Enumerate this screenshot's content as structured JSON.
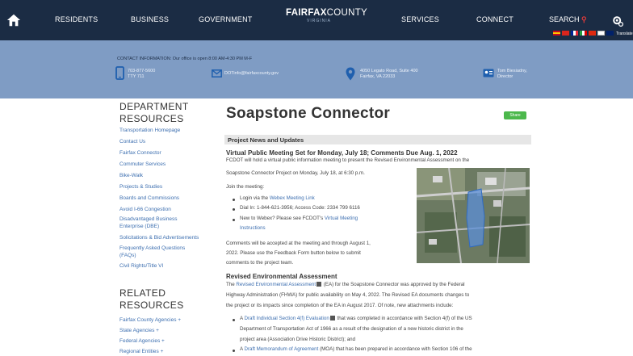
{
  "nav": {
    "residents": "RESIDENTS",
    "business": "BUSINESS",
    "government": "GOVERNMENT",
    "brand_bold": "FAIRFAX",
    "brand_thin": "COUNTY",
    "brand_sub": "VIRGINIA",
    "services": "SERVICES",
    "connect": "CONNECT",
    "search": "SEARCH",
    "translate": "Translate"
  },
  "contact": {
    "label": "CONTACT INFORMATION: Our office is open 8:00 AM-4:30 PM M-F",
    "phone": [
      "703-877-5600",
      "TTY 711"
    ],
    "email": "DOTinfo@fairfaxcounty.gov",
    "address": [
      "4050 Legato Road, Suite 400",
      "Fairfax, VA 22033"
    ],
    "person": [
      "Tom Biesiadny,",
      "Director"
    ]
  },
  "sidebar": {
    "dept_heading": [
      "DEPARTMENT",
      "RESOURCES"
    ],
    "links": [
      "Transportation Homepage",
      "Contact Us",
      "Fairfax Connector",
      "Commuter Services",
      "Bike-Walk",
      "Projects & Studies",
      "Boards and Commissions",
      "Avoid I-66 Congestion",
      "Disadvantaged Business",
      "Enterprise (DBE)",
      "Solicitations & Bid Advertisements",
      "Frequently Asked Questions",
      "(FAQs)",
      "Civil Rights/Title VI"
    ],
    "related_heading": [
      "RELATED",
      "RESOURCES"
    ],
    "related_links": [
      "Fairfax County Agencies  +",
      "State Agencies  +",
      "Federal Agencies  +",
      "Regional Entities  +"
    ]
  },
  "main": {
    "title": "Soapstone Connector",
    "share": "Share",
    "section": "Project News and Updates",
    "h1": "Virtual Public Meeting Set for Monday, July 18; Comments Due Aug. 1, 2022",
    "p1a": "FCDOT will hold a virtual public information meeting to present the Revised Environmental Assessment on the",
    "p1b": "Soapstone Connector Project on Monday, July 18, at 6:30 p.m.",
    "join": "Join the meeting:",
    "b1_pre": "Login via the ",
    "b1_link": "Webex Meeting Link",
    "b2": "Dial In: 1-844-621-3956; Access Code: 2334 799 6116",
    "b3_pre": "New to Webex? Please see FCDOT's ",
    "b3_link": "Virtual Meeting",
    "b3_link2": "Instructions",
    "c1": "Comments will be accepted at the meeting and through August 1,",
    "c2": "2022. Please use the Feedback Form button below to submit",
    "c3": "comments to the project team.",
    "h2": "Revised Environmental Assessment",
    "r1_pre": "The ",
    "r1_link": "Revised Environmental Assessment",
    "r1_post": " (EA) for the Soapstone Connector was approved by the Federal",
    "r2": "Highway Administration (FHWA) for public availability on May 4, 2022. The Revised EA documents changes to",
    "r3": "the project or its impacts since completion of the EA in August 2017. Of note, new attachments include:",
    "d1_pre": "A ",
    "d1_link": "Draft Individual Section 4(f) Evaluation",
    "d1_post": " that was completed in accordance with Section 4(f) of the US",
    "d1_l2": "Department of Transportation Act of 1966 as a result of the designation of a new historic district in the",
    "d1_l3": "project area (Association Drive Historic District); and",
    "d2_pre": "A ",
    "d2_link": "Draft Memorandum of Agreement",
    "d2_post": " (MOA) that has been prepared in accordance with Section 106 of the"
  },
  "colors": {
    "nav_bg": "#1b2c44",
    "contact_bg": "#7f9cc4",
    "link": "#3d6fb0",
    "share_green": "#4cb84c",
    "search_red": "#e23b3b"
  }
}
